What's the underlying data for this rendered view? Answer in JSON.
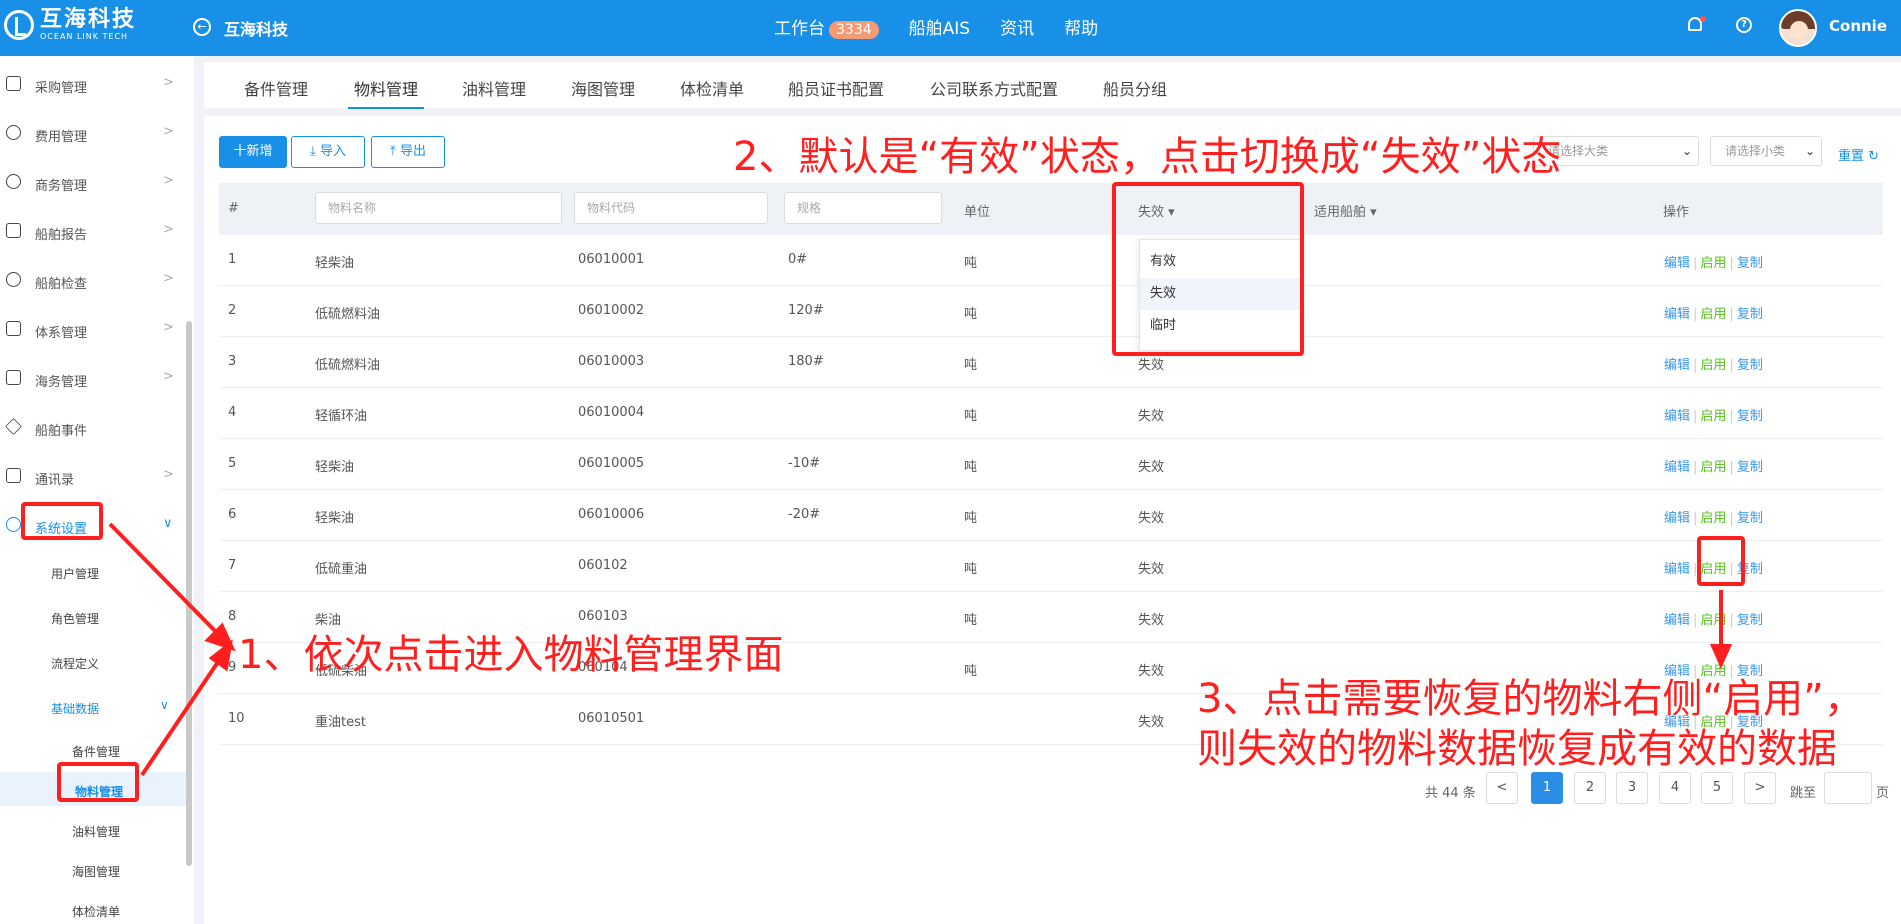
{
  "header": {
    "logo_cn": "互海科技",
    "logo_en": "OCEAN LINK TECH",
    "page_title": "互海科技",
    "nav": [
      {
        "label": "工作台",
        "badge": "3334"
      },
      {
        "label": "船舶AIS"
      },
      {
        "label": "资讯"
      },
      {
        "label": "帮助"
      }
    ],
    "username": "Connie"
  },
  "sidebar": {
    "items": [
      {
        "label": "采购管理",
        "icon": "cart-icon"
      },
      {
        "label": "费用管理",
        "icon": "coins-icon"
      },
      {
        "label": "商务管理",
        "icon": "globe-icon"
      },
      {
        "label": "船舶报告",
        "icon": "calendar-icon"
      },
      {
        "label": "船舶检查",
        "icon": "check-circle-icon"
      },
      {
        "label": "体系管理",
        "icon": "documents-icon"
      },
      {
        "label": "海务管理",
        "icon": "signpost-icon"
      },
      {
        "label": "船舶事件",
        "icon": "warning-icon"
      },
      {
        "label": "通讯录",
        "icon": "contacts-icon"
      },
      {
        "label": "系统设置",
        "icon": "gear-icon"
      }
    ],
    "system_sub": [
      "用户管理",
      "角色管理",
      "流程定义",
      "基础数据"
    ],
    "base_data_sub": [
      "备件管理",
      "物料管理",
      "油料管理",
      "海图管理",
      "体检清单"
    ]
  },
  "tabs": [
    "备件管理",
    "物料管理",
    "油料管理",
    "海图管理",
    "体检清单",
    "船员证书配置",
    "公司联系方式配置",
    "船员分组"
  ],
  "toolbar": {
    "add": "十新增",
    "import": "导入",
    "export": "导出",
    "category_placeholder": "请选择大类",
    "subcategory_placeholder": "请选择小类",
    "reset": "重置"
  },
  "table": {
    "headers": {
      "index": "#",
      "name_placeholder": "物料名称",
      "code_placeholder": "物料代码",
      "spec_placeholder": "规格",
      "unit": "单位",
      "status": "失效",
      "ship": "适用船舶",
      "ops": "操作"
    },
    "rows": [
      {
        "no": "1",
        "name": "轻柴油",
        "code": "06010001",
        "spec": "0#",
        "unit": "吨",
        "status": ""
      },
      {
        "no": "2",
        "name": "低硫燃料油",
        "code": "06010002",
        "spec": "120#",
        "unit": "吨",
        "status": ""
      },
      {
        "no": "3",
        "name": "低硫燃料油",
        "code": "06010003",
        "spec": "180#",
        "unit": "吨",
        "status": "失效"
      },
      {
        "no": "4",
        "name": "轻循环油",
        "code": "06010004",
        "spec": "",
        "unit": "吨",
        "status": "失效"
      },
      {
        "no": "5",
        "name": "轻柴油",
        "code": "06010005",
        "spec": "-10#",
        "unit": "吨",
        "status": "失效"
      },
      {
        "no": "6",
        "name": "轻柴油",
        "code": "06010006",
        "spec": "-20#",
        "unit": "吨",
        "status": "失效"
      },
      {
        "no": "7",
        "name": "低硫重油",
        "code": "060102",
        "spec": "",
        "unit": "吨",
        "status": "失效"
      },
      {
        "no": "8",
        "name": "柴油",
        "code": "060103",
        "spec": "",
        "unit": "吨",
        "status": "失效"
      },
      {
        "no": "9",
        "name": "低硫柴油",
        "code": "060104",
        "spec": "",
        "unit": "吨",
        "status": "失效"
      },
      {
        "no": "10",
        "name": "重油test",
        "code": "06010501",
        "spec": "",
        "unit": "",
        "status": "失效"
      }
    ],
    "actions": {
      "edit": "编辑",
      "enable": "启用",
      "copy": "复制"
    }
  },
  "status_dropdown": [
    "有效",
    "失效",
    "临时"
  ],
  "pagination": {
    "total": "共 44 条",
    "prev": "<",
    "pages": [
      "1",
      "2",
      "3",
      "4",
      "5"
    ],
    "current": "1",
    "next": ">",
    "jump_label": "跳至",
    "page_unit": "页"
  },
  "annotations": {
    "step1": "1、依次点击进入物料管理界面",
    "step2": "2、默认是“有效”状态，点击切换成“失效”状态",
    "step3_line1": "3、点击需要恢复的物料右侧“启用”，",
    "step3_line2": "则失效的物料数据恢复成有效的数据"
  },
  "colors": {
    "primary": "#1890e8",
    "annotation": "#ff1f1f",
    "enable": "#52c41a"
  }
}
